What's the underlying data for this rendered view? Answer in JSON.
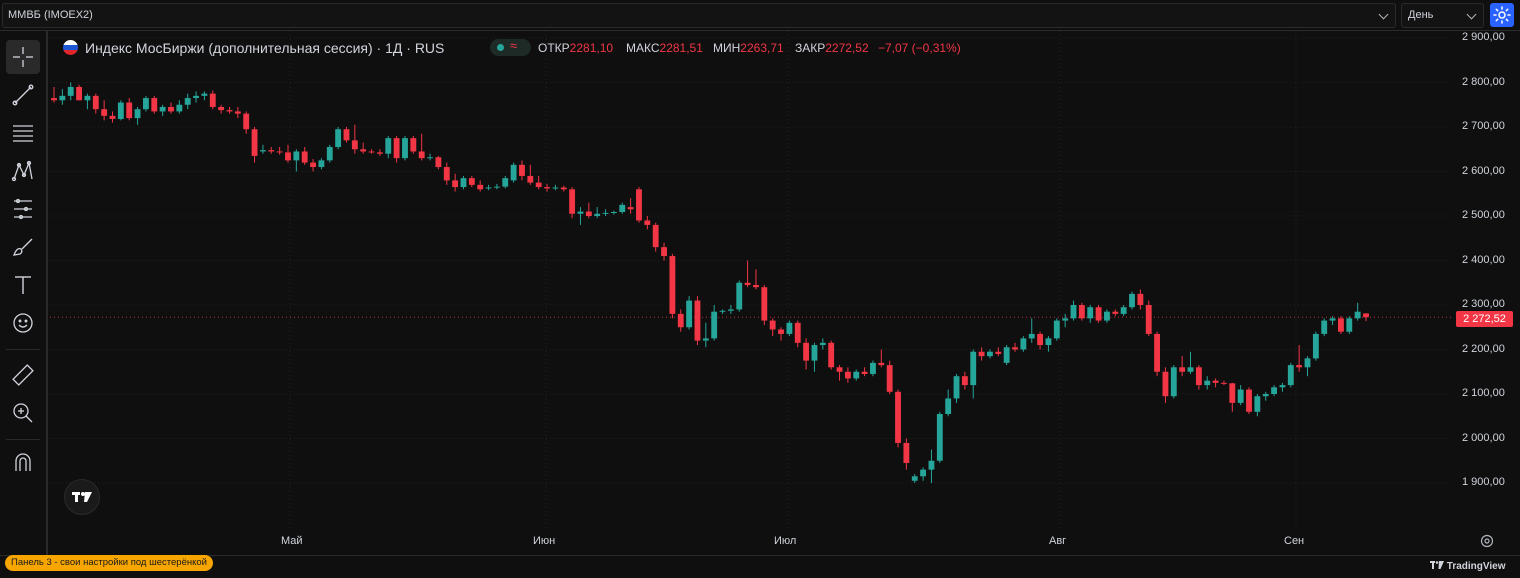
{
  "topbar": {
    "symbol": "ММВБ (IMOEX2)",
    "interval": "День"
  },
  "legend": {
    "title": "Индекс МосБиржи (дополнительная сессия) · 1Д · RUS",
    "open_label": "ОТКР",
    "open_value": "2281,10",
    "high_label": "МАКС",
    "high_value": "2281,51",
    "low_label": "МИН",
    "low_value": "2263,71",
    "close_label": "ЗАКР",
    "close_value": "2272,52",
    "change": "−7,07 (−0,31%)"
  },
  "last_price_label": "2 272,52",
  "price_axis_labels": [
    "2 900,00",
    "2 800,00",
    "2 700,00",
    "2 600,00",
    "2 500,00",
    "2 400,00",
    "2 300,00",
    "2 200,00",
    "2 100,00",
    "2 000,00",
    "1 900,00"
  ],
  "time_axis_labels": [
    "Май",
    "Июн",
    "Июл",
    "Авг",
    "Сен"
  ],
  "bottom": {
    "panel_note": "Панель 3 - свои настройки под шестерёнкой",
    "brand": "TradingView"
  },
  "colors": {
    "up": "#26a69a",
    "down": "#f23645",
    "accent": "#2962ff",
    "badge": "#f7a600"
  },
  "chart_data": {
    "type": "candlestick",
    "ylim": [
      1860,
      2920
    ],
    "last_price": 2272.52,
    "candles": [
      {
        "o": 2765,
        "h": 2790,
        "l": 2755,
        "c": 2760
      },
      {
        "o": 2760,
        "h": 2785,
        "l": 2750,
        "c": 2770
      },
      {
        "o": 2770,
        "h": 2800,
        "l": 2760,
        "c": 2790
      },
      {
        "o": 2790,
        "h": 2795,
        "l": 2760,
        "c": 2760
      },
      {
        "o": 2760,
        "h": 2775,
        "l": 2740,
        "c": 2770
      },
      {
        "o": 2770,
        "h": 2775,
        "l": 2730,
        "c": 2740
      },
      {
        "o": 2740,
        "h": 2760,
        "l": 2715,
        "c": 2725
      },
      {
        "o": 2725,
        "h": 2735,
        "l": 2710,
        "c": 2718
      },
      {
        "o": 2718,
        "h": 2760,
        "l": 2715,
        "c": 2755
      },
      {
        "o": 2755,
        "h": 2765,
        "l": 2715,
        "c": 2720
      },
      {
        "o": 2720,
        "h": 2745,
        "l": 2705,
        "c": 2740
      },
      {
        "o": 2740,
        "h": 2770,
        "l": 2735,
        "c": 2765
      },
      {
        "o": 2765,
        "h": 2770,
        "l": 2730,
        "c": 2735
      },
      {
        "o": 2735,
        "h": 2750,
        "l": 2725,
        "c": 2745
      },
      {
        "o": 2745,
        "h": 2755,
        "l": 2730,
        "c": 2735
      },
      {
        "o": 2735,
        "h": 2760,
        "l": 2730,
        "c": 2750
      },
      {
        "o": 2750,
        "h": 2775,
        "l": 2740,
        "c": 2765
      },
      {
        "o": 2765,
        "h": 2780,
        "l": 2755,
        "c": 2770
      },
      {
        "o": 2770,
        "h": 2780,
        "l": 2760,
        "c": 2775
      },
      {
        "o": 2775,
        "h": 2782,
        "l": 2740,
        "c": 2745
      },
      {
        "o": 2745,
        "h": 2750,
        "l": 2730,
        "c": 2738
      },
      {
        "o": 2738,
        "h": 2745,
        "l": 2730,
        "c": 2735
      },
      {
        "o": 2735,
        "h": 2745,
        "l": 2720,
        "c": 2730
      },
      {
        "o": 2730,
        "h": 2735,
        "l": 2685,
        "c": 2695
      },
      {
        "o": 2695,
        "h": 2700,
        "l": 2620,
        "c": 2635
      },
      {
        "o": 2645,
        "h": 2660,
        "l": 2640,
        "c": 2648
      },
      {
        "o": 2648,
        "h": 2655,
        "l": 2640,
        "c": 2645
      },
      {
        "o": 2645,
        "h": 2655,
        "l": 2638,
        "c": 2643
      },
      {
        "o": 2643,
        "h": 2660,
        "l": 2620,
        "c": 2625
      },
      {
        "o": 2625,
        "h": 2650,
        "l": 2600,
        "c": 2645
      },
      {
        "o": 2645,
        "h": 2655,
        "l": 2615,
        "c": 2620
      },
      {
        "o": 2620,
        "h": 2628,
        "l": 2600,
        "c": 2610
      },
      {
        "o": 2610,
        "h": 2630,
        "l": 2605,
        "c": 2625
      },
      {
        "o": 2625,
        "h": 2660,
        "l": 2620,
        "c": 2655
      },
      {
        "o": 2655,
        "h": 2700,
        "l": 2650,
        "c": 2695
      },
      {
        "o": 2695,
        "h": 2700,
        "l": 2665,
        "c": 2670
      },
      {
        "o": 2670,
        "h": 2705,
        "l": 2640,
        "c": 2650
      },
      {
        "o": 2650,
        "h": 2665,
        "l": 2640,
        "c": 2645
      },
      {
        "o": 2645,
        "h": 2650,
        "l": 2640,
        "c": 2643
      },
      {
        "o": 2643,
        "h": 2650,
        "l": 2635,
        "c": 2640
      },
      {
        "o": 2640,
        "h": 2680,
        "l": 2630,
        "c": 2675
      },
      {
        "o": 2675,
        "h": 2680,
        "l": 2620,
        "c": 2630
      },
      {
        "o": 2630,
        "h": 2680,
        "l": 2625,
        "c": 2675
      },
      {
        "o": 2675,
        "h": 2680,
        "l": 2640,
        "c": 2645
      },
      {
        "o": 2645,
        "h": 2685,
        "l": 2625,
        "c": 2630
      },
      {
        "o": 2630,
        "h": 2640,
        "l": 2625,
        "c": 2632
      },
      {
        "o": 2632,
        "h": 2635,
        "l": 2605,
        "c": 2610
      },
      {
        "o": 2610,
        "h": 2620,
        "l": 2570,
        "c": 2580
      },
      {
        "o": 2580,
        "h": 2595,
        "l": 2555,
        "c": 2565
      },
      {
        "o": 2565,
        "h": 2590,
        "l": 2560,
        "c": 2585
      },
      {
        "o": 2585,
        "h": 2590,
        "l": 2565,
        "c": 2570
      },
      {
        "o": 2570,
        "h": 2580,
        "l": 2555,
        "c": 2560
      },
      {
        "o": 2562,
        "h": 2570,
        "l": 2558,
        "c": 2564
      },
      {
        "o": 2564,
        "h": 2572,
        "l": 2560,
        "c": 2566
      },
      {
        "o": 2566,
        "h": 2590,
        "l": 2562,
        "c": 2585
      },
      {
        "o": 2580,
        "h": 2620,
        "l": 2575,
        "c": 2615
      },
      {
        "o": 2615,
        "h": 2625,
        "l": 2580,
        "c": 2590
      },
      {
        "o": 2590,
        "h": 2615,
        "l": 2570,
        "c": 2575
      },
      {
        "o": 2575,
        "h": 2590,
        "l": 2560,
        "c": 2565
      },
      {
        "o": 2565,
        "h": 2572,
        "l": 2555,
        "c": 2562
      },
      {
        "o": 2562,
        "h": 2570,
        "l": 2558,
        "c": 2564
      },
      {
        "o": 2564,
        "h": 2568,
        "l": 2555,
        "c": 2560
      },
      {
        "o": 2560,
        "h": 2565,
        "l": 2495,
        "c": 2505
      },
      {
        "o": 2505,
        "h": 2520,
        "l": 2480,
        "c": 2510
      },
      {
        "o": 2510,
        "h": 2530,
        "l": 2495,
        "c": 2500
      },
      {
        "o": 2500,
        "h": 2520,
        "l": 2495,
        "c": 2505
      },
      {
        "o": 2505,
        "h": 2515,
        "l": 2500,
        "c": 2507
      },
      {
        "o": 2507,
        "h": 2512,
        "l": 2503,
        "c": 2509
      },
      {
        "o": 2509,
        "h": 2530,
        "l": 2505,
        "c": 2525
      },
      {
        "o": 2520,
        "h": 2540,
        "l": 2505,
        "c": 2515
      },
      {
        "o": 2560,
        "h": 2565,
        "l": 2485,
        "c": 2490
      },
      {
        "o": 2490,
        "h": 2500,
        "l": 2470,
        "c": 2480
      },
      {
        "o": 2480,
        "h": 2485,
        "l": 2420,
        "c": 2430
      },
      {
        "o": 2430,
        "h": 2440,
        "l": 2400,
        "c": 2410
      },
      {
        "o": 2410,
        "h": 2415,
        "l": 2270,
        "c": 2280
      },
      {
        "o": 2280,
        "h": 2290,
        "l": 2240,
        "c": 2250
      },
      {
        "o": 2250,
        "h": 2320,
        "l": 2245,
        "c": 2310
      },
      {
        "o": 2310,
        "h": 2320,
        "l": 2210,
        "c": 2220
      },
      {
        "o": 2220,
        "h": 2260,
        "l": 2205,
        "c": 2225
      },
      {
        "o": 2225,
        "h": 2300,
        "l": 2220,
        "c": 2285
      },
      {
        "o": 2285,
        "h": 2290,
        "l": 2280,
        "c": 2287
      },
      {
        "o": 2287,
        "h": 2300,
        "l": 2280,
        "c": 2290
      },
      {
        "o": 2290,
        "h": 2355,
        "l": 2285,
        "c": 2350
      },
      {
        "o": 2350,
        "h": 2400,
        "l": 2340,
        "c": 2345
      },
      {
        "o": 2345,
        "h": 2380,
        "l": 2335,
        "c": 2340
      },
      {
        "o": 2340,
        "h": 2345,
        "l": 2255,
        "c": 2265
      },
      {
        "o": 2265,
        "h": 2270,
        "l": 2230,
        "c": 2245
      },
      {
        "o": 2245,
        "h": 2250,
        "l": 2220,
        "c": 2235
      },
      {
        "o": 2235,
        "h": 2265,
        "l": 2230,
        "c": 2260
      },
      {
        "o": 2260,
        "h": 2265,
        "l": 2205,
        "c": 2215
      },
      {
        "o": 2215,
        "h": 2225,
        "l": 2155,
        "c": 2175
      },
      {
        "o": 2175,
        "h": 2215,
        "l": 2150,
        "c": 2210
      },
      {
        "o": 2210,
        "h": 2225,
        "l": 2200,
        "c": 2215
      },
      {
        "o": 2215,
        "h": 2220,
        "l": 2155,
        "c": 2160
      },
      {
        "o": 2160,
        "h": 2165,
        "l": 2130,
        "c": 2150
      },
      {
        "o": 2150,
        "h": 2160,
        "l": 2125,
        "c": 2135
      },
      {
        "o": 2135,
        "h": 2155,
        "l": 2130,
        "c": 2150
      },
      {
        "o": 2150,
        "h": 2160,
        "l": 2140,
        "c": 2145
      },
      {
        "o": 2145,
        "h": 2175,
        "l": 2140,
        "c": 2170
      },
      {
        "o": 2170,
        "h": 2200,
        "l": 2160,
        "c": 2165
      },
      {
        "o": 2165,
        "h": 2175,
        "l": 2100,
        "c": 2105
      },
      {
        "o": 2105,
        "h": 2110,
        "l": 1980,
        "c": 1990
      },
      {
        "o": 1990,
        "h": 2000,
        "l": 1930,
        "c": 1945
      },
      {
        "o": 1905,
        "h": 1920,
        "l": 1900,
        "c": 1915
      },
      {
        "o": 1915,
        "h": 1935,
        "l": 1905,
        "c": 1930
      },
      {
        "o": 1930,
        "h": 1975,
        "l": 1900,
        "c": 1950
      },
      {
        "o": 1950,
        "h": 2060,
        "l": 1945,
        "c": 2055
      },
      {
        "o": 2055,
        "h": 2110,
        "l": 2050,
        "c": 2090
      },
      {
        "o": 2090,
        "h": 2145,
        "l": 2080,
        "c": 2140
      },
      {
        "o": 2140,
        "h": 2150,
        "l": 2110,
        "c": 2120
      },
      {
        "o": 2120,
        "h": 2200,
        "l": 2090,
        "c": 2195
      },
      {
        "o": 2195,
        "h": 2205,
        "l": 2175,
        "c": 2185
      },
      {
        "o": 2185,
        "h": 2200,
        "l": 2180,
        "c": 2195
      },
      {
        "o": 2195,
        "h": 2205,
        "l": 2185,
        "c": 2190
      },
      {
        "o": 2170,
        "h": 2210,
        "l": 2165,
        "c": 2205
      },
      {
        "o": 2205,
        "h": 2215,
        "l": 2195,
        "c": 2200
      },
      {
        "o": 2200,
        "h": 2230,
        "l": 2195,
        "c": 2225
      },
      {
        "o": 2225,
        "h": 2270,
        "l": 2215,
        "c": 2235
      },
      {
        "o": 2235,
        "h": 2240,
        "l": 2200,
        "c": 2210
      },
      {
        "o": 2210,
        "h": 2230,
        "l": 2195,
        "c": 2225
      },
      {
        "o": 2225,
        "h": 2270,
        "l": 2220,
        "c": 2265
      },
      {
        "o": 2265,
        "h": 2280,
        "l": 2250,
        "c": 2270
      },
      {
        "o": 2270,
        "h": 2310,
        "l": 2265,
        "c": 2300
      },
      {
        "o": 2300,
        "h": 2305,
        "l": 2265,
        "c": 2270
      },
      {
        "o": 2270,
        "h": 2300,
        "l": 2260,
        "c": 2295
      },
      {
        "o": 2295,
        "h": 2300,
        "l": 2260,
        "c": 2265
      },
      {
        "o": 2265,
        "h": 2290,
        "l": 2260,
        "c": 2285
      },
      {
        "o": 2285,
        "h": 2290,
        "l": 2275,
        "c": 2280
      },
      {
        "o": 2280,
        "h": 2300,
        "l": 2275,
        "c": 2295
      },
      {
        "o": 2295,
        "h": 2330,
        "l": 2290,
        "c": 2325
      },
      {
        "o": 2325,
        "h": 2335,
        "l": 2290,
        "c": 2300
      },
      {
        "o": 2300,
        "h": 2310,
        "l": 2230,
        "c": 2235
      },
      {
        "o": 2235,
        "h": 2240,
        "l": 2140,
        "c": 2150
      },
      {
        "o": 2150,
        "h": 2160,
        "l": 2080,
        "c": 2095
      },
      {
        "o": 2095,
        "h": 2165,
        "l": 2090,
        "c": 2160
      },
      {
        "o": 2160,
        "h": 2185,
        "l": 2140,
        "c": 2150
      },
      {
        "o": 2150,
        "h": 2195,
        "l": 2145,
        "c": 2160
      },
      {
        "o": 2160,
        "h": 2165,
        "l": 2110,
        "c": 2120
      },
      {
        "o": 2120,
        "h": 2140,
        "l": 2110,
        "c": 2130
      },
      {
        "o": 2130,
        "h": 2135,
        "l": 2115,
        "c": 2125
      },
      {
        "o": 2125,
        "h": 2130,
        "l": 2120,
        "c": 2124
      },
      {
        "o": 2124,
        "h": 2125,
        "l": 2060,
        "c": 2080
      },
      {
        "o": 2080,
        "h": 2120,
        "l": 2075,
        "c": 2110
      },
      {
        "o": 2110,
        "h": 2115,
        "l": 2055,
        "c": 2060
      },
      {
        "o": 2060,
        "h": 2100,
        "l": 2050,
        "c": 2095
      },
      {
        "o": 2095,
        "h": 2105,
        "l": 2085,
        "c": 2100
      },
      {
        "o": 2100,
        "h": 2120,
        "l": 2095,
        "c": 2115
      },
      {
        "o": 2115,
        "h": 2125,
        "l": 2105,
        "c": 2120
      },
      {
        "o": 2120,
        "h": 2170,
        "l": 2115,
        "c": 2165
      },
      {
        "o": 2165,
        "h": 2210,
        "l": 2150,
        "c": 2160
      },
      {
        "o": 2160,
        "h": 2185,
        "l": 2140,
        "c": 2180
      },
      {
        "o": 2180,
        "h": 2240,
        "l": 2175,
        "c": 2235
      },
      {
        "o": 2235,
        "h": 2270,
        "l": 2230,
        "c": 2265
      },
      {
        "o": 2265,
        "h": 2275,
        "l": 2255,
        "c": 2270
      },
      {
        "o": 2270,
        "h": 2275,
        "l": 2235,
        "c": 2240
      },
      {
        "o": 2240,
        "h": 2275,
        "l": 2235,
        "c": 2270
      },
      {
        "o": 2270,
        "h": 2305,
        "l": 2265,
        "c": 2285
      },
      {
        "o": 2281.1,
        "h": 2281.51,
        "l": 2263.71,
        "c": 2272.52
      }
    ]
  }
}
